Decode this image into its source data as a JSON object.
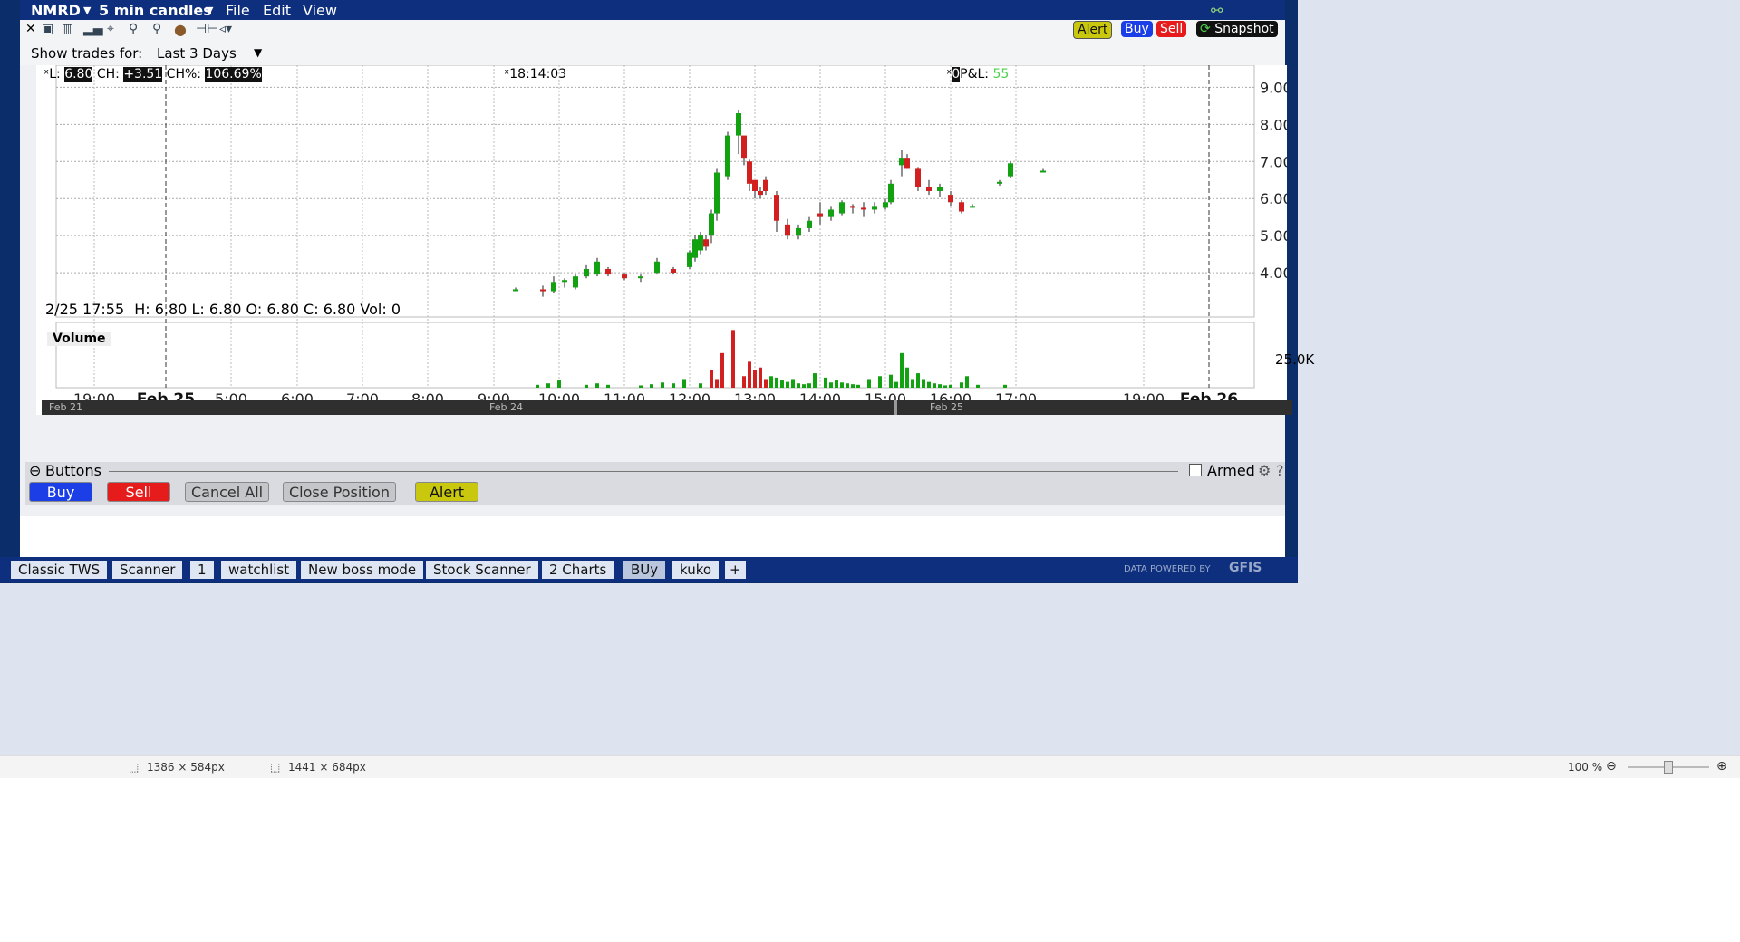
{
  "window": {
    "symbol": "NMRD",
    "timeframe": "5 min candles",
    "menu": [
      "File",
      "Edit",
      "View"
    ]
  },
  "header_buttons": {
    "alert": "Alert",
    "buy": "Buy",
    "sell": "Sell",
    "snapshot": "Snapshot"
  },
  "trades": {
    "label": "Show trades for:",
    "value": "Last 3 Days"
  },
  "chart_info": {
    "l_label": "L:",
    "l_value": "6.80",
    "ch_label": "CH:",
    "ch_value": "+3.51",
    "chp_label": "CH%:",
    "chp_value": "106.69%",
    "time": "18:14:03",
    "pl_value": "0",
    "pl_label": "P&L:",
    "pl_amount": "55",
    "ohlc_date": "2/25 17:55",
    "ohlc": "H: 6.80  L: 6.80  O: 6.80  C: 6.80  Vol: 0",
    "volume_label": "Volume",
    "volume_tick": "25.0K"
  },
  "chart_data": {
    "type": "candlestick",
    "title": "",
    "ylim": [
      3.0,
      9.4
    ],
    "y_ticks": [
      "9.00",
      "8.00",
      "7.00",
      "6.00",
      "5.00",
      "4.00"
    ],
    "x_ticks": [
      "19:00",
      "Feb 25",
      "5:00",
      "6:00",
      "7:00",
      "8:00",
      "9:00",
      "10:00",
      "11:00",
      "12:00",
      "13:00",
      "14:00",
      "15:00",
      "16:00",
      "17:00",
      "19:00",
      "Feb 26"
    ],
    "candles": [
      {
        "t": "9:05",
        "o": 3.55,
        "h": 3.6,
        "l": 3.5,
        "c": 3.55
      },
      {
        "t": "9:30",
        "o": 3.55,
        "h": 3.65,
        "l": 3.35,
        "c": 3.5
      },
      {
        "t": "9:40",
        "o": 3.5,
        "h": 3.9,
        "l": 3.45,
        "c": 3.75
      },
      {
        "t": "9:50",
        "o": 3.75,
        "h": 3.85,
        "l": 3.6,
        "c": 3.8
      },
      {
        "t": "10:00",
        "o": 3.6,
        "h": 3.95,
        "l": 3.55,
        "c": 3.9
      },
      {
        "t": "10:10",
        "o": 3.9,
        "h": 4.2,
        "l": 3.85,
        "c": 4.1
      },
      {
        "t": "10:20",
        "o": 3.95,
        "h": 4.4,
        "l": 3.9,
        "c": 4.3
      },
      {
        "t": "10:30",
        "o": 4.1,
        "h": 4.15,
        "l": 3.9,
        "c": 3.95
      },
      {
        "t": "10:45",
        "o": 3.95,
        "h": 4.0,
        "l": 3.8,
        "c": 3.85
      },
      {
        "t": "11:00",
        "o": 3.85,
        "h": 3.95,
        "l": 3.75,
        "c": 3.9
      },
      {
        "t": "11:15",
        "o": 4.0,
        "h": 4.4,
        "l": 3.95,
        "c": 4.3
      },
      {
        "t": "11:30",
        "o": 4.1,
        "h": 4.15,
        "l": 3.95,
        "c": 4.0
      },
      {
        "t": "11:45",
        "o": 4.15,
        "h": 4.6,
        "l": 4.1,
        "c": 4.55
      },
      {
        "t": "11:50",
        "o": 4.4,
        "h": 5.0,
        "l": 4.3,
        "c": 4.9
      },
      {
        "t": "11:55",
        "o": 4.6,
        "h": 5.1,
        "l": 4.5,
        "c": 5.0
      },
      {
        "t": "12:00",
        "o": 4.9,
        "h": 5.0,
        "l": 4.6,
        "c": 4.7
      },
      {
        "t": "12:05",
        "o": 5.0,
        "h": 5.7,
        "l": 4.8,
        "c": 5.6
      },
      {
        "t": "12:10",
        "o": 5.6,
        "h": 6.8,
        "l": 5.4,
        "c": 6.7
      },
      {
        "t": "12:20",
        "o": 6.6,
        "h": 7.8,
        "l": 6.5,
        "c": 7.7
      },
      {
        "t": "12:30",
        "o": 7.7,
        "h": 8.4,
        "l": 7.2,
        "c": 8.3
      },
      {
        "t": "12:35",
        "o": 7.7,
        "h": 7.7,
        "l": 6.9,
        "c": 7.1
      },
      {
        "t": "12:40",
        "o": 7.0,
        "h": 7.05,
        "l": 6.2,
        "c": 6.4
      },
      {
        "t": "12:45",
        "o": 6.5,
        "h": 6.5,
        "l": 6.0,
        "c": 6.2
      },
      {
        "t": "12:50",
        "o": 6.2,
        "h": 6.3,
        "l": 6.0,
        "c": 6.1
      },
      {
        "t": "12:55",
        "o": 6.5,
        "h": 6.6,
        "l": 6.1,
        "c": 6.2
      },
      {
        "t": "13:05",
        "o": 6.1,
        "h": 6.2,
        "l": 5.1,
        "c": 5.4
      },
      {
        "t": "13:15",
        "o": 5.3,
        "h": 5.45,
        "l": 4.9,
        "c": 5.0
      },
      {
        "t": "13:25",
        "o": 5.0,
        "h": 5.3,
        "l": 4.9,
        "c": 5.2
      },
      {
        "t": "13:35",
        "o": 5.2,
        "h": 5.5,
        "l": 5.1,
        "c": 5.4
      },
      {
        "t": "13:45",
        "o": 5.6,
        "h": 5.9,
        "l": 5.3,
        "c": 5.5
      },
      {
        "t": "13:55",
        "o": 5.5,
        "h": 5.8,
        "l": 5.4,
        "c": 5.7
      },
      {
        "t": "14:05",
        "o": 5.6,
        "h": 5.95,
        "l": 5.55,
        "c": 5.9
      },
      {
        "t": "14:15",
        "o": 5.8,
        "h": 5.85,
        "l": 5.6,
        "c": 5.75
      },
      {
        "t": "14:25",
        "o": 5.75,
        "h": 5.9,
        "l": 5.5,
        "c": 5.7
      },
      {
        "t": "14:35",
        "o": 5.7,
        "h": 5.9,
        "l": 5.6,
        "c": 5.8
      },
      {
        "t": "14:45",
        "o": 5.75,
        "h": 6.0,
        "l": 5.7,
        "c": 5.9
      },
      {
        "t": "14:50",
        "o": 5.9,
        "h": 6.5,
        "l": 5.85,
        "c": 6.4
      },
      {
        "t": "15:00",
        "o": 6.9,
        "h": 7.3,
        "l": 6.6,
        "c": 7.1
      },
      {
        "t": "15:05",
        "o": 7.1,
        "h": 7.2,
        "l": 6.8,
        "c": 6.8
      },
      {
        "t": "15:15",
        "o": 6.8,
        "h": 6.85,
        "l": 6.2,
        "c": 6.3
      },
      {
        "t": "15:25",
        "o": 6.3,
        "h": 6.5,
        "l": 6.1,
        "c": 6.2
      },
      {
        "t": "15:35",
        "o": 6.2,
        "h": 6.4,
        "l": 6.05,
        "c": 6.3
      },
      {
        "t": "15:45",
        "o": 6.1,
        "h": 6.2,
        "l": 5.8,
        "c": 5.9
      },
      {
        "t": "15:55",
        "o": 5.9,
        "h": 5.95,
        "l": 5.6,
        "c": 5.65
      },
      {
        "t": "16:05",
        "o": 5.8,
        "h": 5.85,
        "l": 5.75,
        "c": 5.8
      },
      {
        "t": "16:30",
        "o": 6.4,
        "h": 6.5,
        "l": 6.35,
        "c": 6.45
      },
      {
        "t": "16:40",
        "o": 6.6,
        "h": 7.0,
        "l": 6.55,
        "c": 6.95
      },
      {
        "t": "17:10",
        "o": 6.75,
        "h": 6.8,
        "l": 6.7,
        "c": 6.75
      }
    ],
    "volume": [
      {
        "t": "9:25",
        "v": 1000
      },
      {
        "t": "9:35",
        "v": 1500
      },
      {
        "t": "9:45",
        "v": 2500
      },
      {
        "t": "10:10",
        "v": 1000
      },
      {
        "t": "10:20",
        "v": 1500
      },
      {
        "t": "10:30",
        "v": 1000
      },
      {
        "t": "11:00",
        "v": 800
      },
      {
        "t": "11:10",
        "v": 1200
      },
      {
        "t": "11:20",
        "v": 1800
      },
      {
        "t": "11:30",
        "v": 1500
      },
      {
        "t": "11:40",
        "v": 3000
      },
      {
        "t": "11:55",
        "v": 1500
      },
      {
        "t": "12:05",
        "v": 6000
      },
      {
        "t": "12:10",
        "v": 3000
      },
      {
        "t": "12:15",
        "v": 12000
      },
      {
        "t": "12:25",
        "v": 20000
      },
      {
        "t": "12:35",
        "v": 4000
      },
      {
        "t": "12:40",
        "v": 9000
      },
      {
        "t": "12:45",
        "v": 6000
      },
      {
        "t": "12:50",
        "v": 7000
      },
      {
        "t": "12:55",
        "v": 3000
      },
      {
        "t": "13:00",
        "v": 4000
      },
      {
        "t": "13:05",
        "v": 3500
      },
      {
        "t": "13:10",
        "v": 2500
      },
      {
        "t": "13:15",
        "v": 2000
      },
      {
        "t": "13:20",
        "v": 3000
      },
      {
        "t": "13:25",
        "v": 1500
      },
      {
        "t": "13:30",
        "v": 1200
      },
      {
        "t": "13:35",
        "v": 1500
      },
      {
        "t": "13:40",
        "v": 5000
      },
      {
        "t": "13:50",
        "v": 3500
      },
      {
        "t": "13:55",
        "v": 1800
      },
      {
        "t": "14:00",
        "v": 2500
      },
      {
        "t": "14:05",
        "v": 1800
      },
      {
        "t": "14:10",
        "v": 1500
      },
      {
        "t": "14:15",
        "v": 1200
      },
      {
        "t": "14:20",
        "v": 1000
      },
      {
        "t": "14:30",
        "v": 3000
      },
      {
        "t": "14:40",
        "v": 4000
      },
      {
        "t": "14:50",
        "v": 4500
      },
      {
        "t": "14:55",
        "v": 2000
      },
      {
        "t": "15:00",
        "v": 12000
      },
      {
        "t": "15:05",
        "v": 7000
      },
      {
        "t": "15:10",
        "v": 3000
      },
      {
        "t": "15:15",
        "v": 5000
      },
      {
        "t": "15:20",
        "v": 3000
      },
      {
        "t": "15:25",
        "v": 2000
      },
      {
        "t": "15:30",
        "v": 1500
      },
      {
        "t": "15:35",
        "v": 1200
      },
      {
        "t": "15:40",
        "v": 800
      },
      {
        "t": "15:45",
        "v": 1000
      },
      {
        "t": "15:55",
        "v": 1800
      },
      {
        "t": "16:00",
        "v": 4000
      },
      {
        "t": "16:10",
        "v": 1000
      },
      {
        "t": "16:35",
        "v": 1000
      }
    ]
  },
  "scrollbar_dates": [
    "Feb 21",
    "Feb 24",
    "Feb 25"
  ],
  "buttons_panel": {
    "title": "Buttons",
    "buy": "Buy",
    "sell": "Sell",
    "cancel_all": "Cancel All",
    "close_position": "Close Position",
    "alert": "Alert",
    "armed": "Armed"
  },
  "tabs": [
    "Classic TWS",
    "Scanner",
    "1",
    "watchlist",
    "New boss mode",
    "Stock Scanner",
    "2 Charts",
    "BUy",
    "kuko",
    "+"
  ],
  "powered_by": "DATA POWERED BY",
  "powered_brand": "GFIS",
  "status": {
    "size1": "1386 × 584px",
    "size2": "1441 × 684px",
    "zoom": "100 %"
  },
  "colors": {
    "up": "#11a111",
    "down": "#d21f1f",
    "title_bg": "#0d2f7e",
    "alert": "#c9c80e",
    "buy": "#1b3ee6",
    "sell": "#e61b1b"
  }
}
